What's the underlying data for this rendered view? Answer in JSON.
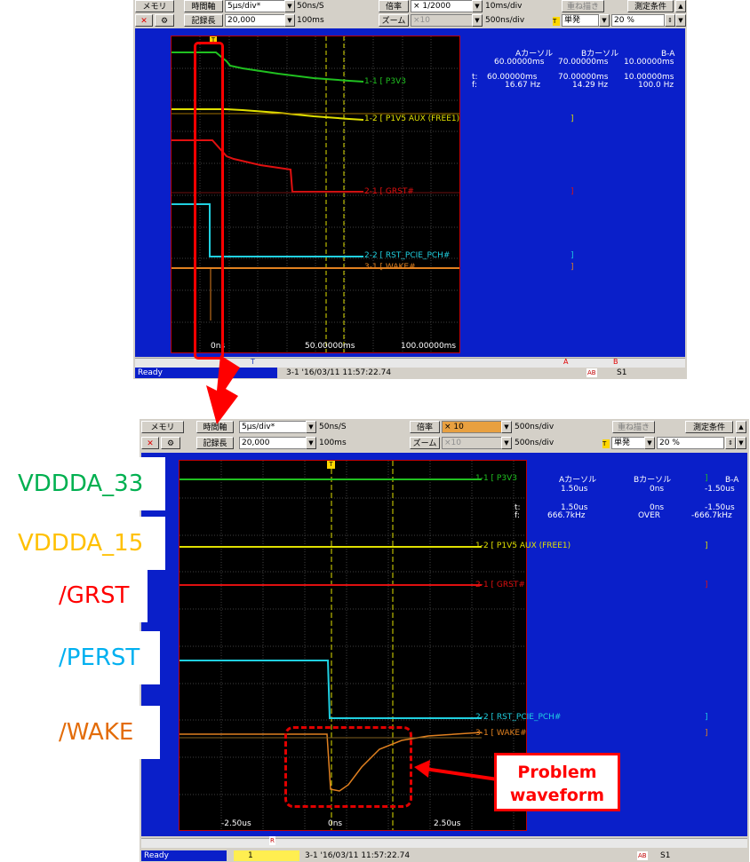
{
  "top_window": {
    "toolbar": {
      "memory_label": "メモリ",
      "timeaxis_label": "時間軸",
      "timeaxis_value": "5μs/div*",
      "sample_rate": "50ns/S",
      "record_label": "記録長",
      "record_value": "20,000",
      "record_time": "100ms",
      "mag_label": "倍率",
      "mag_value": "× 1/2000",
      "mag_div": "10ms/div",
      "zoom_label": "ズーム",
      "zoom_value": "×10",
      "zoom_div": "500ns/div",
      "overlay_label": "重ね描き",
      "measure_label": "測定条件",
      "trigger_mode": "単発",
      "percent_value": "20 %"
    },
    "cursor_info": {
      "a_header": "Aカーソル",
      "b_header": "Bカーソル",
      "ba_header": "B-A",
      "a_top": "60.00000ms",
      "b_top": "70.00000ms",
      "ba_top": "10.00000ms",
      "t_label": "t:",
      "f_label": "f:",
      "a_t": "60.00000ms",
      "b_t": "70.00000ms",
      "ba_t": "10.00000ms",
      "a_f": "16.67 Hz",
      "b_f": "14.29 Hz",
      "ba_f": "100.0 Hz"
    },
    "channels": [
      {
        "label": "1-1  [ P3V3",
        "bracket": "",
        "color": "#20c020"
      },
      {
        "label": "1-2  [ P1V5 AUX (FREE1)",
        "bracket": "]",
        "color": "#f0f000"
      },
      {
        "label": "2-1  [ GRST#",
        "bracket": "]",
        "color": "#e01010"
      },
      {
        "label": "2-2  [ RST_PCIE_PCH#",
        "bracket": "]",
        "color": "#20d0e0"
      },
      {
        "label": "3-1  [ WAKE#",
        "bracket": "]",
        "color": "#e08020"
      }
    ],
    "trigger_marker": "T",
    "xticks": [
      "0ns",
      "50.00000ms",
      "100.00000ms"
    ],
    "scroll_markers": {
      "t": "T",
      "a": "A",
      "b": "B"
    },
    "status": {
      "ready": "Ready",
      "file": "3-1 '16/03/11 11:57:22.74",
      "ab": "AB",
      "s1": "S1"
    }
  },
  "bottom_window": {
    "toolbar": {
      "memory_label": "メモリ",
      "timeaxis_label": "時間軸",
      "timeaxis_value": "5μs/div*",
      "sample_rate": "50ns/S",
      "record_label": "記録長",
      "record_value": "20,000",
      "record_time": "100ms",
      "mag_label": "倍率",
      "mag_value": "× 10",
      "mag_div": "500ns/div",
      "zoom_label": "ズーム",
      "zoom_value": "×10",
      "zoom_div": "500ns/div",
      "overlay_label": "重ね描き",
      "measure_label": "測定条件",
      "trigger_mode": "単発",
      "percent_value": "20 %"
    },
    "cursor_info": {
      "a_header": "Aカーソル",
      "b_header": "Bカーソル",
      "ba_header": "B-A",
      "a_top": "1.50us",
      "b_top": "0ns",
      "ba_top": "-1.50us",
      "t_label": "t:",
      "f_label": "f:",
      "a_t": "1.50us",
      "b_t": "0ns",
      "ba_t": "-1.50us",
      "a_f": "666.7kHz",
      "b_f": "OVER",
      "ba_f": "-666.7kHz"
    },
    "channels": [
      {
        "label": "1-1  [ P3V3",
        "bracket": "]",
        "color": "#20c020"
      },
      {
        "label": "1-2  [ P1V5 AUX (FREE1)",
        "bracket": "]",
        "color": "#e0e000"
      },
      {
        "label": "2-1  [ GRST#",
        "bracket": "]",
        "color": "#e01010"
      },
      {
        "label": "2-2  [ RST_PCIE_PCH#",
        "bracket": "]",
        "color": "#20d0e0"
      },
      {
        "label": "3-1  [ WAKE#",
        "bracket": "]",
        "color": "#e08020"
      }
    ],
    "trigger_marker": "T",
    "xticks": [
      "-2.50us",
      "0ns",
      "2.50us"
    ],
    "scroll_markers": {
      "r": "R"
    },
    "status": {
      "ready": "Ready",
      "page": "1",
      "file": "3-1 '16/03/11 11:57:22.74",
      "ab": "AB",
      "s1": "S1"
    }
  },
  "signal_names": [
    {
      "text": "VDDDA_33",
      "color": "#00b050"
    },
    {
      "text": "VDDDA_15",
      "color": "#ffc000"
    },
    {
      "text": "/GRST",
      "color": "#ff0000"
    },
    {
      "text": "/PERST",
      "color": "#00b0f0"
    },
    {
      "text": "/WAKE",
      "color": "#e36c09"
    }
  ],
  "callout": {
    "text_line1": "Problem",
    "text_line2": "waveform",
    "color": "#ff0000"
  }
}
